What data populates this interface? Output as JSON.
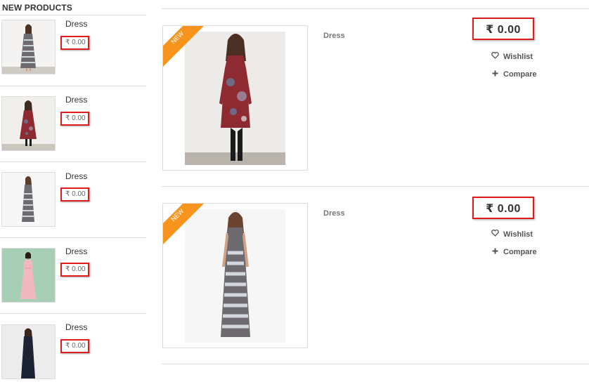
{
  "sidebar": {
    "title": "NEW PRODUCTS",
    "items": [
      {
        "name": "Dress",
        "price": "₹ 0.00"
      },
      {
        "name": "Dress",
        "price": "₹ 0.00"
      },
      {
        "name": "Dress",
        "price": "₹ 0.00"
      },
      {
        "name": "Dress",
        "price": "₹ 0.00"
      },
      {
        "name": "Dress",
        "price": "₹ 0.00"
      }
    ]
  },
  "products": [
    {
      "badge": "NEW",
      "name": "Dress",
      "price": "₹ 0.00",
      "wishlist_label": "Wishlist",
      "compare_label": "Compare"
    },
    {
      "badge": "NEW",
      "name": "Dress",
      "price": "₹ 0.00",
      "wishlist_label": "Wishlist",
      "compare_label": "Compare"
    }
  ],
  "colors": {
    "highlight_border": "#e01b1b",
    "badge_orange": "#f7941d",
    "dress_red": "#8e2a32",
    "dress_stripe": "#6d6b6f",
    "dress_pink": "#f2b8bf",
    "dress_navy": "#1c2333",
    "thumb_green_bg": "#a6cfb5"
  }
}
